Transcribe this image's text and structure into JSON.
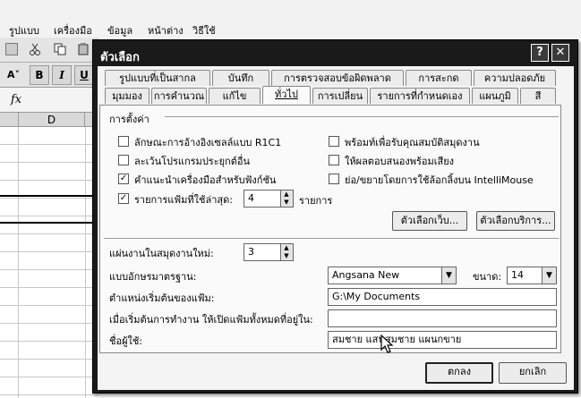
{
  "excel": {
    "menus": [
      "รูปแบบ",
      "เครื่องมือ",
      "ข้อมูล",
      "หน้าต่าง",
      "วิธีใช้"
    ],
    "toolbar_buttons": [
      "B",
      "I",
      "U"
    ],
    "font_size_icon": "A˅",
    "formula_fx": "fx",
    "column_header": "D"
  },
  "dialog": {
    "title": "ตัวเลือก",
    "help_glyph": "?",
    "close_glyph": "✕",
    "tabs_row1": [
      "รูปแบบที่เป็นสากล",
      "บันทึก",
      "การตรวจสอบข้อผิดพลาด",
      "การสะกด",
      "ความปลอดภัย"
    ],
    "tabs_row2": [
      "มุมมอง",
      "การคำนวณ",
      "แก้ไข",
      "ทั่วไป",
      "การเปลี่ยน",
      "รายการที่กำหนดเอง",
      "แผนภูมิ",
      "สี"
    ],
    "active_tab": "ทั่วไป",
    "settings_group": "การตั้งค่า",
    "checkboxes": [
      {
        "label": "ลักษณะการอ้างอิงเซลล์แบบ R1C1",
        "checked": false
      },
      {
        "label": "ละเว้นโปรแกรมประยุกต์อื่น",
        "checked": false
      },
      {
        "label": "คำแนะนำเครื่องมือสำหรับฟังก์ชัน",
        "checked": true
      },
      {
        "label": "รายการแฟ้มที่ใช้ล่าสุด:",
        "checked": true
      },
      {
        "label": "พร้อมท์เพื่อรับคุณสมบัติสมุดงาน",
        "checked": false
      },
      {
        "label": "ให้ผลตอบสนองพร้อมเสียง",
        "checked": false
      },
      {
        "label": "ย่อ/ขยายโดยการใช้ล้อกลิ้งบน IntelliMouse",
        "checked": false
      }
    ],
    "check_glyph": "✓",
    "recent_files_count": "4",
    "recent_files_unit": "รายการ",
    "web_options_button": "ตัวเลือกเว็บ...",
    "service_options_button": "ตัวเลือกบริการ...",
    "sheets_label": "แผ่นงานในสมุดงานใหม่:",
    "sheets_value": "3",
    "font_label": "แบบอักษรมาตรฐาน:",
    "font_value": "Angsana New",
    "size_label": "ขนาด:",
    "size_value": "14",
    "location_label": "ตำแหน่งเริ่มต้นของแฟ้ม:",
    "location_value": "G:\\My Documents",
    "startup_label": "เมื่อเริ่มต้นการทำงาน ให้เปิดแฟ้มทั้งหมดที่อยู่ใน:",
    "startup_value": "",
    "username_label": "ชื่อผู้ใช้:",
    "username_value": "สมชาย แสนสมชาย แผนกขาย",
    "ok_button": "ตกลง",
    "cancel_button": "ยกเลิก",
    "spin_up": "▲",
    "spin_down": "▼",
    "dropdown_glyph": "▼"
  }
}
